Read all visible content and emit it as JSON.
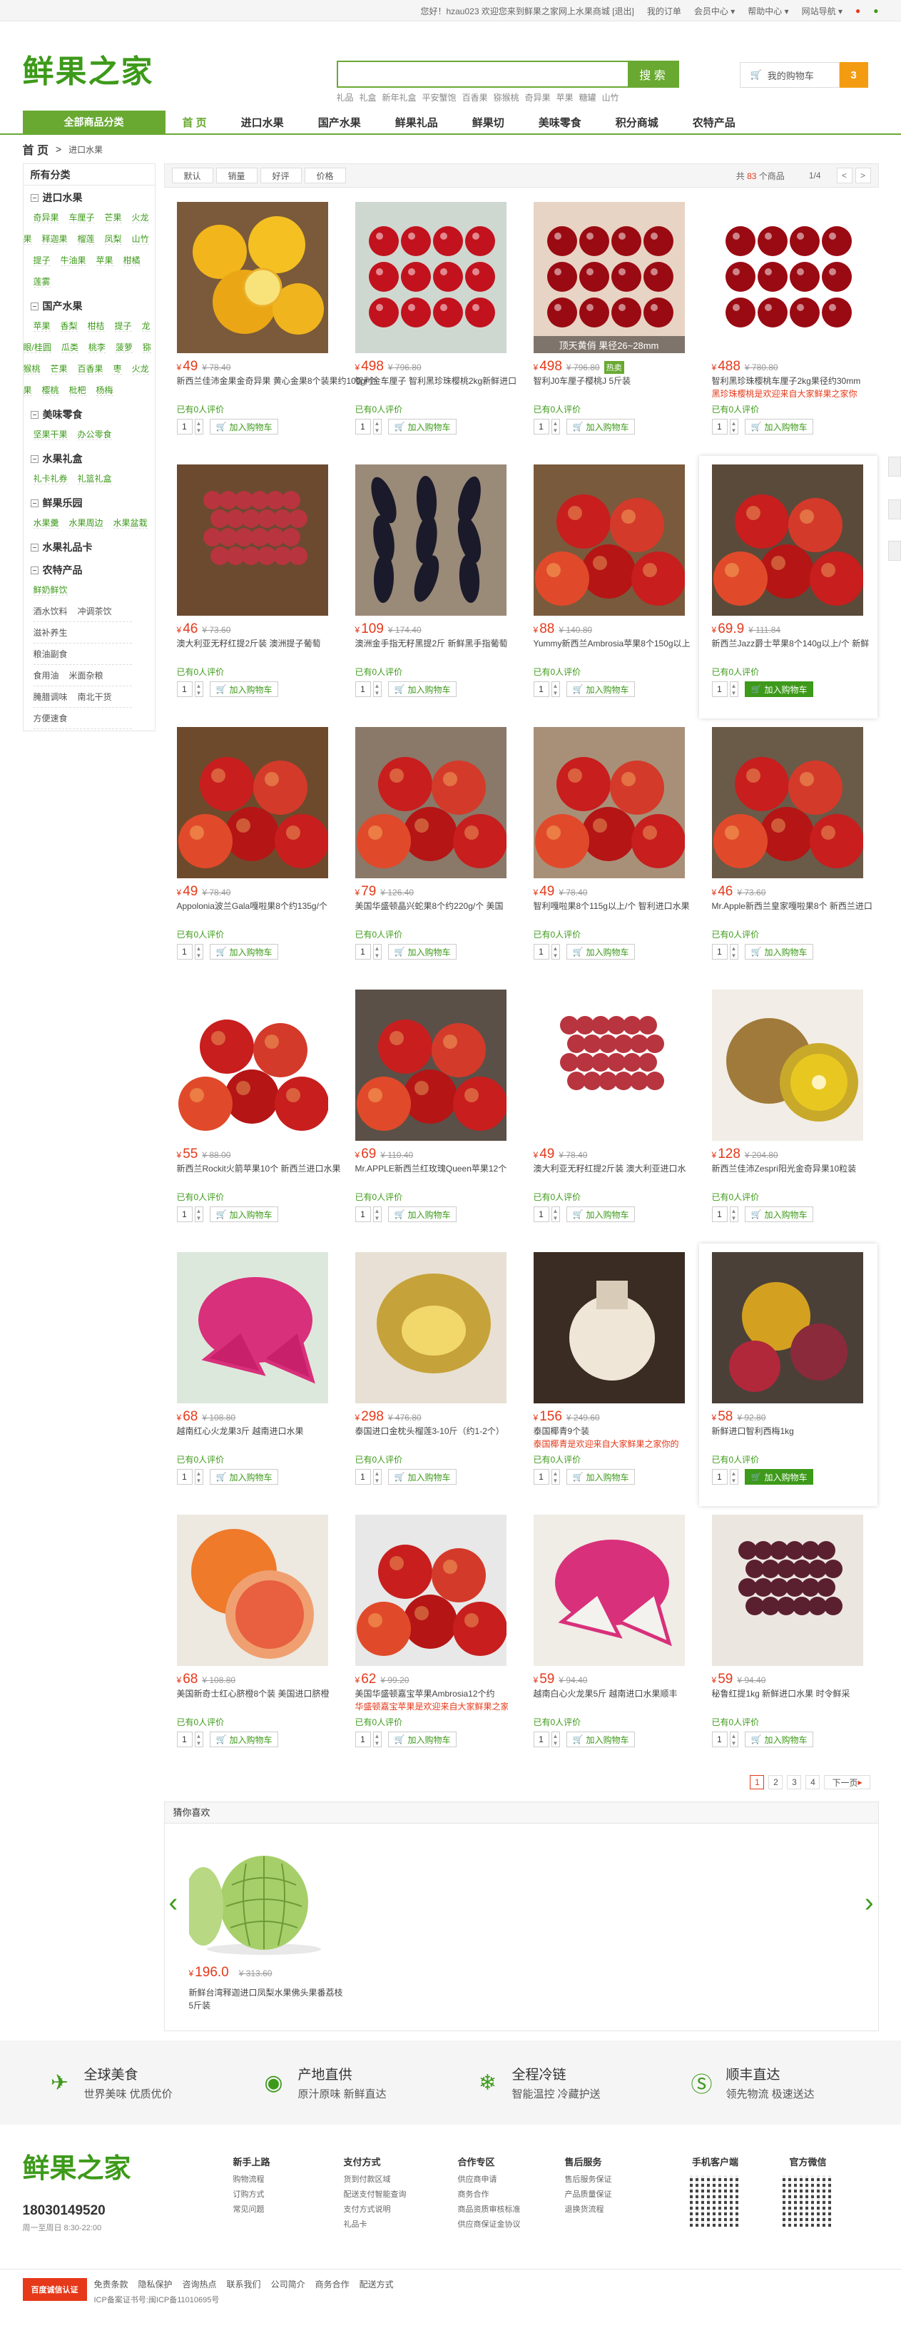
{
  "topbar": {
    "greeting": "您好！hzau023 欢迎您来到鲜果之家网上水果商城",
    "logout": "[退出]",
    "links": [
      "我的订单",
      "会员中心",
      "帮助中心",
      "网站导航"
    ]
  },
  "header": {
    "logo_text": "鲜果之家",
    "search_placeholder": "",
    "search_button": "搜 索",
    "hotwords": [
      "礼品",
      "礼盒",
      "新年礼盒",
      "平安蟹饱",
      "百香果",
      "猕猴桃",
      "奇异果",
      "苹果",
      "糖罐",
      "山竹"
    ],
    "cart_label": "我的购物车",
    "cart_count": "3"
  },
  "nav": {
    "all_category": "全部商品分类",
    "items": [
      "首 页",
      "进口水果",
      "国产水果",
      "鲜果礼品",
      "鲜果切",
      "美味零食",
      "积分商城",
      "农特产品"
    ]
  },
  "breadcrumb": {
    "home": "首 页",
    "separator": ">",
    "current": "进口水果"
  },
  "sidebar": {
    "title": "所有分类",
    "groups": [
      {
        "name": "进口水果",
        "items": [
          "奇异果",
          "车厘子",
          "芒果",
          "火龙果",
          "释迦果",
          "榴莲",
          "凤梨",
          "山竹",
          "提子",
          "牛油果",
          "苹果",
          "柑橘",
          "莲雾"
        ]
      },
      {
        "name": "国产水果",
        "items": [
          "苹果",
          "香梨",
          "柑桔",
          "提子",
          "龙眼/桂圆",
          "瓜类",
          "桃李",
          "菠萝",
          "猕猴桃",
          "芒果",
          "百香果",
          "枣",
          "火龙果",
          "樱桃",
          "枇杷",
          "杨梅"
        ]
      },
      {
        "name": "美味零食",
        "items": [
          "坚果干果",
          "办公零食"
        ]
      },
      {
        "name": "水果礼盒",
        "items": [
          "礼卡礼券",
          "礼篮礼盒"
        ]
      },
      {
        "name": "鲜果乐园",
        "items": [
          "水果羹",
          "水果周边",
          "水果盆栽"
        ]
      },
      {
        "name": "水果礼品卡",
        "items": []
      },
      {
        "name": "农特产品",
        "items": [
          "鲜奶鲜饮"
        ],
        "plain_rows": [
          [
            "酒水饮料",
            "冲调茶饮"
          ],
          [
            "滋补养生"
          ],
          [
            "粮油副食"
          ],
          [
            "食用油",
            "米面杂粮"
          ],
          [
            "腌腊调味",
            "南北干货"
          ],
          [
            "方便速食"
          ]
        ]
      }
    ]
  },
  "sortbar": {
    "buttons": [
      "默认",
      "销量",
      "好评",
      "价格"
    ],
    "total_prefix": "共",
    "total_count": "83",
    "total_suffix": "个商品",
    "page_info": "1/4",
    "prev": "<",
    "next": ">"
  },
  "products": [
    {
      "price": "49",
      "old": "78.40",
      "name": "新西兰佳沛金果金奇异果 黄心金果8个装果约100g/个",
      "promo": "",
      "review": "已有0人评价",
      "img": "citrus"
    },
    {
      "price": "498",
      "old": "796.80",
      "name": "智利金车厘子 智利黑珍珠樱桃2kg新鲜进口",
      "promo": "",
      "review": "已有0人评价",
      "img": "cherry"
    },
    {
      "price": "498",
      "old": "796.80",
      "badge": "热卖",
      "tag": "顶天黄俏 果径26~28mm",
      "name": "智利J0车厘子樱桃J 5斤装",
      "promo": "",
      "review": "已有0人评价",
      "img": "cherry2"
    },
    {
      "price": "488",
      "old": "780.80",
      "name": "智利黑珍珠樱桃车厘子2kg果径约30mm",
      "promo": "黑珍珠樱桃是欢迎来自大家鲜果之家你",
      "review": "已有0人评价",
      "img": "cherry3"
    },
    {
      "price": "46",
      "old": "73.60",
      "name": "澳大利亚无籽红提2斤装 澳洲提子葡萄",
      "promo": "",
      "review": "已有0人评价",
      "img": "grape"
    },
    {
      "price": "109",
      "old": "174.40",
      "name": "澳洲金手指无籽黑提2斤 新鲜黑手指葡萄",
      "promo": "",
      "review": "已有0人评价",
      "img": "blackgrape"
    },
    {
      "price": "88",
      "old": "140.80",
      "name": "Yummy新西兰Ambrosia苹果8个150g以上",
      "promo": "",
      "review": "已有0人评价",
      "img": "apple"
    },
    {
      "price": "69.9",
      "old": "111.84",
      "name": "新西兰Jazz爵士苹果8个140g以上/个 新鲜",
      "promo": "",
      "review": "已有0人评价",
      "img": "apple2",
      "highlight": true
    },
    {
      "price": "49",
      "old": "78.40",
      "name": "Appolonia波兰Gala嘎啦果8个约135g/个",
      "promo": "",
      "review": "已有0人评价",
      "img": "apple3"
    },
    {
      "price": "79",
      "old": "126.40",
      "name": "美国华盛顿晶兴蛇果8个约220g/个 美国",
      "promo": "",
      "review": "已有0人评价",
      "img": "apple4"
    },
    {
      "price": "49",
      "old": "78.40",
      "name": "智利嘎啦果8个115g以上/个 智利进口水果",
      "promo": "",
      "review": "已有0人评价",
      "img": "apple5"
    },
    {
      "price": "46",
      "old": "73.60",
      "name": "Mr.Apple新西兰皇家嘎啦果8个 新西兰进口",
      "promo": "",
      "review": "已有0人评价",
      "img": "apple6"
    },
    {
      "price": "55",
      "old": "88.00",
      "name": "新西兰Rockit火箭苹果10个 新西兰进口水果",
      "promo": "",
      "review": "已有0人评价",
      "img": "apple7"
    },
    {
      "price": "69",
      "old": "110.40",
      "name": "Mr.APPLE新西兰红玫瑰Queen苹果12个",
      "promo": "",
      "review": "已有0人评价",
      "img": "apple8"
    },
    {
      "price": "49",
      "old": "78.40",
      "name": "澳大利亚无籽红提2斤装 澳大利亚进口水",
      "promo": "",
      "review": "已有0人评价",
      "img": "grape2"
    },
    {
      "price": "128",
      "old": "204.80",
      "name": "新西兰佳沛Zespri阳光金奇异果10粒装",
      "promo": "",
      "review": "已有0人评价",
      "img": "kiwi"
    },
    {
      "price": "68",
      "old": "108.80",
      "name": "越南红心火龙果3斤 越南进口水果",
      "promo": "",
      "review": "已有0人评价",
      "img": "dragon"
    },
    {
      "price": "298",
      "old": "476.80",
      "name": "泰国进口金枕头榴莲3-10斤（约1-2个）",
      "promo": "",
      "review": "已有0人评价",
      "img": "durian"
    },
    {
      "price": "156",
      "old": "249.60",
      "name": "泰国椰青9个装",
      "promo": "泰国椰青是欢迎来自大家鲜果之家你的",
      "review": "已有0人评价",
      "img": "coconut"
    },
    {
      "price": "58",
      "old": "92.80",
      "name": "新鲜进口智利西梅1kg",
      "promo": "",
      "review": "已有0人评价",
      "img": "plum",
      "highlight": true
    },
    {
      "price": "68",
      "old": "108.80",
      "name": "美国新奇士红心脐橙8个装 美国进口脐橙",
      "promo": "",
      "review": "已有0人评价",
      "img": "orange"
    },
    {
      "price": "62",
      "old": "99.20",
      "name": "美国华盛顿嘉宝苹果Ambrosia12个约",
      "promo": "华盛顿嘉宝苹果是欢迎来自大家鲜果之家",
      "review": "已有0人评价",
      "img": "apple9"
    },
    {
      "price": "59",
      "old": "94.40",
      "name": "越南白心火龙果5斤 越南进口水果顺丰",
      "promo": "",
      "review": "已有0人评价",
      "img": "dragon2"
    },
    {
      "price": "59",
      "old": "94.40",
      "name": "秘鲁红提1kg 新鲜进口水果 时令鲜采",
      "promo": "",
      "review": "已有0人评价",
      "img": "redgrape"
    }
  ],
  "buy": {
    "qty": "1",
    "add_label": "加入购物车"
  },
  "pager": {
    "pages": [
      "1",
      "2",
      "3",
      "4"
    ],
    "next": "下一页"
  },
  "guess": {
    "title": "猜你喜欢",
    "item": {
      "price": "196.0",
      "old": "313.60",
      "name": "新鲜台湾释迦进口凤梨水果佛头果番荔枝5斤装"
    }
  },
  "services": [
    {
      "t1": "全球美食",
      "t2": "世界美味 优质优价",
      "icon": "plane-icon"
    },
    {
      "t1": "产地直供",
      "t2": "原汁原味 新鲜直达",
      "icon": "globe-icon"
    },
    {
      "t1": "全程冷链",
      "t2": "智能温控 冷藏护送",
      "icon": "snowflake-icon"
    },
    {
      "t1": "顺丰直达",
      "t2": "领先物流 极速送达",
      "icon": "sf-icon"
    }
  ],
  "footer": {
    "logo_text": "鲜果之家",
    "phone": "18030149520",
    "hours": "周一至周日 8:30-22:00",
    "cols": [
      {
        "h": "新手上路",
        "l": [
          "购物流程",
          "订购方式",
          "常见问题"
        ]
      },
      {
        "h": "支付方式",
        "l": [
          "货到付款区域",
          "配送支付智能查询",
          "支付方式说明",
          "礼品卡"
        ]
      },
      {
        "h": "合作专区",
        "l": [
          "供应商申请",
          "商务合作",
          "商品资质审核标准",
          "供应商保证金协议"
        ]
      },
      {
        "h": "售后服务",
        "l": [
          "售后服务保证",
          "产品质量保证",
          "退换货流程"
        ]
      }
    ],
    "qr": [
      "手机客户端",
      "官方微信"
    ]
  },
  "bottom": {
    "cert": "百度诚信认证",
    "links": [
      "免责条款",
      "隐私保护",
      "咨询热点",
      "联系我们",
      "公司简介",
      "商务合作",
      "配送方式"
    ],
    "icp": "ICP备案证书号:闽ICP备11010695号"
  }
}
